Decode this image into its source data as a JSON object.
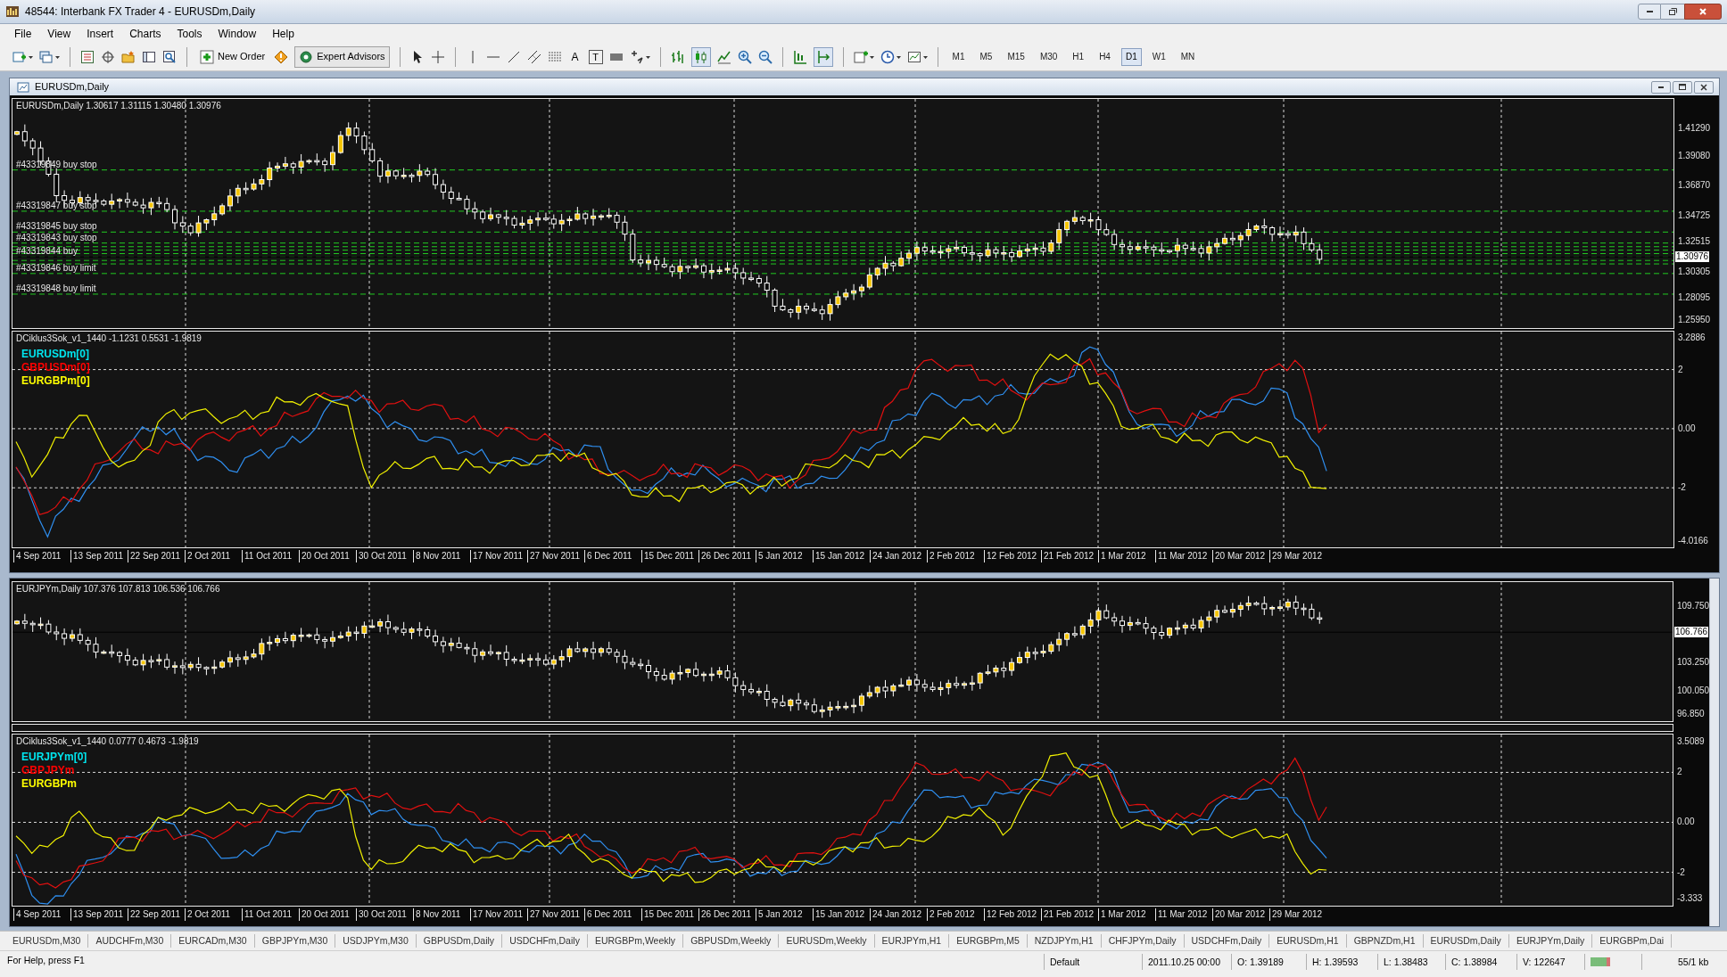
{
  "window": {
    "title": "48544: Interbank FX Trader 4 - EURUSDm,Daily"
  },
  "menu": [
    "File",
    "View",
    "Insert",
    "Charts",
    "Tools",
    "Window",
    "Help"
  ],
  "toolbar": {
    "new_order": "New Order",
    "expert_advisors": "Expert Advisors",
    "glyphs": [
      "A",
      "T"
    ],
    "timeframes": [
      {
        "label": "M1",
        "selected": false
      },
      {
        "label": "M5",
        "selected": false
      },
      {
        "label": "M15",
        "selected": false
      },
      {
        "label": "M30",
        "selected": false
      },
      {
        "label": "H1",
        "selected": false
      },
      {
        "label": "H4",
        "selected": false
      },
      {
        "label": "D1",
        "selected": true
      },
      {
        "label": "W1",
        "selected": false
      },
      {
        "label": "MN",
        "selected": false
      }
    ]
  },
  "charts": [
    {
      "title": "EURUSDm,Daily",
      "main": {
        "header": "EURUSDm,Daily 1.30617 1.31115 1.30480 1.30976",
        "price_labels": [
          "1.41290",
          "1.39080",
          "1.36870",
          "1.34725",
          "1.32515",
          "1.30305",
          "1.28095",
          "1.25950"
        ],
        "current_price": "1.30976",
        "orders": [
          {
            "label": "#43319849 buy stop"
          },
          {
            "label": "#43319847 buy stop"
          },
          {
            "label": "#43319845 buy stop"
          },
          {
            "label": "#43319843 buy stop"
          },
          {
            "label": "#43319844 buy"
          },
          {
            "label": "#43319846 buy limit"
          },
          {
            "label": "#43319848 buy limit"
          }
        ]
      },
      "indicator": {
        "header": "DCiklus3Sok_v1_1440 -1.1231 0.5531 -1.9819",
        "legend": [
          {
            "text": "EURUSDm[0]",
            "color": "#00e5ee"
          },
          {
            "text": "GBPUSDm[0]",
            "color": "#ff0000"
          },
          {
            "text": "EURGBPm[0]",
            "color": "#ffff00"
          }
        ],
        "scale_labels": [
          "3.2886",
          "2",
          "0.00",
          "-2",
          "-4.0166"
        ]
      },
      "dates": [
        "4 Sep 2011",
        "13 Sep 2011",
        "22 Sep 2011",
        "2 Oct 2011",
        "11 Oct 2011",
        "20 Oct 2011",
        "30 Oct 2011",
        "8 Nov 2011",
        "17 Nov 2011",
        "27 Nov 2011",
        "6 Dec 2011",
        "15 Dec 2011",
        "26 Dec 2011",
        "5 Jan 2012",
        "15 Jan 2012",
        "24 Jan 2012",
        "2 Feb 2012",
        "12 Feb 2012",
        "21 Feb 2012",
        "1 Mar 2012",
        "11 Mar 2012",
        "20 Mar 2012",
        "29 Mar 2012"
      ]
    },
    {
      "main": {
        "header": "EURJPYm,Daily 107.376 107.813 106.536 106.766",
        "price_labels": [
          "109.750",
          "103.250",
          "100.050",
          "96.850"
        ],
        "current_price": "106.766"
      },
      "indicator": {
        "header": "DCiklus3Sok_v1_1440 0.0777 0.4673 -1.9819",
        "legend": [
          {
            "text": "EURJPYm[0]",
            "color": "#00e5ee"
          },
          {
            "text": "GBPJPYm",
            "color": "#ff0000"
          },
          {
            "text": "EURGBPm",
            "color": "#ffff00"
          }
        ],
        "scale_labels": [
          "3.5089",
          "2",
          "0.00",
          "-2",
          "-3.333"
        ]
      },
      "dates": [
        "4 Sep 2011",
        "13 Sep 2011",
        "22 Sep 2011",
        "2 Oct 2011",
        "11 Oct 2011",
        "20 Oct 2011",
        "30 Oct 2011",
        "8 Nov 2011",
        "17 Nov 2011",
        "27 Nov 2011",
        "6 Dec 2011",
        "15 Dec 2011",
        "26 Dec 2011",
        "5 Jan 2012",
        "15 Jan 2012",
        "24 Jan 2012",
        "2 Feb 2012",
        "12 Feb 2012",
        "21 Feb 2012",
        "1 Mar 2012",
        "11 Mar 2012",
        "20 Mar 2012",
        "29 Mar 2012"
      ]
    }
  ],
  "tabs": [
    "EURUSDm,M30",
    "AUDCHFm,M30",
    "EURCADm,M30",
    "GBPJPYm,M30",
    "USDJPYm,M30",
    "GBPUSDm,Daily",
    "USDCHFm,Daily",
    "EURGBPm,Weekly",
    "GBPUSDm,Weekly",
    "EURUSDm,Weekly",
    "EURJPYm,H1",
    "EURGBPm,M5",
    "NZDJPYm,H1",
    "CHFJPYm,Daily",
    "USDCHFm,Daily",
    "EURUSDm,H1",
    "GBPNZDm,H1",
    "EURUSDm,Daily",
    "EURJPYm,Daily",
    "EURGBPm,Dai"
  ],
  "status_bar": {
    "help": "For Help, press F1",
    "profile": "Default",
    "time": "2011.10.25 00:00",
    "open": "O: 1.39189",
    "high": "H: 1.39593",
    "low": "L: 1.38483",
    "close": "C: 1.38984",
    "volume": "V: 122647",
    "traffic": "55/1 kb"
  }
}
